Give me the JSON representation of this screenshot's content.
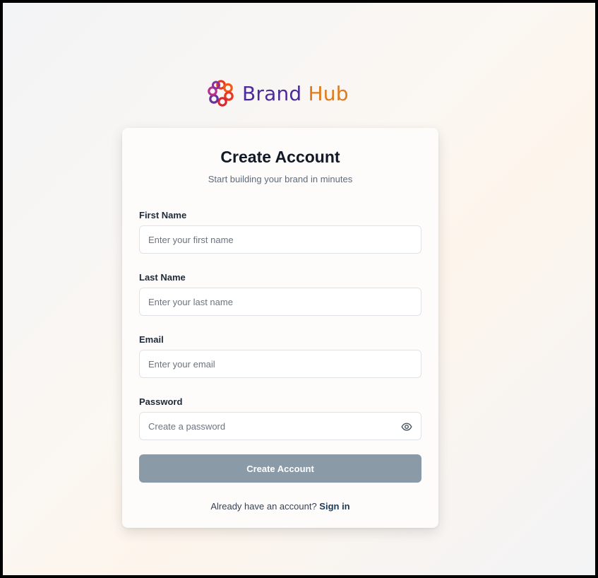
{
  "brand": {
    "name_part1": "Brand",
    "name_part2": "Hub",
    "logo_icon": "flower-logo-icon",
    "colors": {
      "purple": "#4b2a9b",
      "orange": "#e07a1c",
      "red": "#e8391e",
      "magenta": "#b5318e"
    }
  },
  "form": {
    "title": "Create Account",
    "subtitle": "Start building your brand in minutes",
    "fields": [
      {
        "label": "First Name",
        "placeholder": "Enter your first name",
        "value": ""
      },
      {
        "label": "Last Name",
        "placeholder": "Enter your last name",
        "value": ""
      },
      {
        "label": "Email",
        "placeholder": "Enter your email",
        "value": ""
      },
      {
        "label": "Password",
        "placeholder": "Create a password",
        "value": "",
        "toggle_icon": "eye-icon"
      }
    ],
    "submit_label": "Create Account",
    "submit_color": "#8a9aa6",
    "footer_text": "Already have an account?",
    "footer_link": "Sign in"
  }
}
